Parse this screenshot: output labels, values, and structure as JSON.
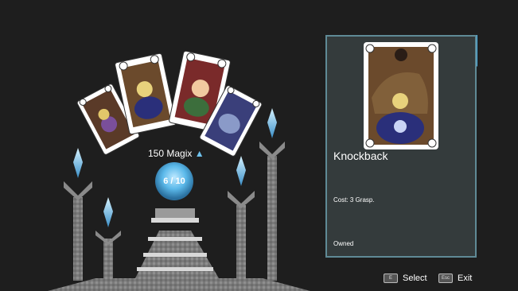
{
  "magix_label": "150 Magix",
  "orb": {
    "current": 6,
    "max": 10,
    "text": "6 / 10"
  },
  "detail": {
    "title": "Knockback",
    "cost": "Cost: 3 Grasp.",
    "status": "Owned"
  },
  "hints": {
    "select_key": "E",
    "select_label": "Select",
    "exit_key": "Esc",
    "exit_label": "Exit"
  },
  "colors": {
    "background": "#1e1e1e",
    "panel": "#343b3c",
    "panel_border": "#5f8a96",
    "crystal": "#4fb3e8",
    "stone": "#8d8d8d"
  }
}
